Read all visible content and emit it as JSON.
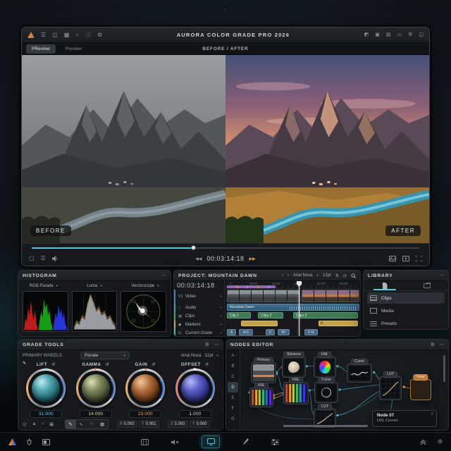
{
  "glyphs": {
    "menu": "☰",
    "dots": "⋯",
    "chev": "▾",
    "gear": "⚙",
    "info": "ⓘ",
    "reset": "↺",
    "prev": "‹",
    "next": "›",
    "close": "×",
    "plus": "+",
    "dot": "·",
    "updown": "⇅",
    "clock": "◷",
    "rew": "◀◀",
    "ffwd": "▶▶",
    "stop": "▢",
    "list": "☰",
    "grid": "▦",
    "circle": "○",
    "panel1": "▣",
    "panel2": "◩",
    "panel3": "▤",
    "panel4": "▭",
    "panel5": "◫",
    "pencil": "✎"
  },
  "titlebar": {
    "title": "AURORA COLOR GRADE PRO 2026"
  },
  "tabs": {
    "tab1": "PReview",
    "tab2": "Preview",
    "center": "BEFORE / AFTER"
  },
  "viewer": {
    "before": "BEFORE",
    "after": "AFTER"
  },
  "transport": {
    "timecode": "00:03:14:18",
    "progress_pct": 42
  },
  "histogram": {
    "title": "HISTOGRAM",
    "scopes": [
      "RGB Parade",
      "Luma",
      "Vectorscope"
    ]
  },
  "project": {
    "title": "PROJECT: MOUNTAIN DAWN",
    "timecode": "00:03:14:18",
    "font": "Arial Nova",
    "size": "12pt",
    "ruler": [
      "0",
      "00:01",
      "00:02",
      "00:03",
      "00:04",
      "00:05"
    ],
    "tracks": [
      {
        "badge": "V1",
        "label": "Video"
      },
      {
        "badge": "♪",
        "label": "Audio"
      },
      {
        "badge": "▤",
        "label": "Clips"
      },
      {
        "badge": "◆",
        "label": "Markers"
      },
      {
        "badge": "G",
        "label": "Current Grade"
      }
    ],
    "audio_clip": "Mountain Dawn",
    "clips": [
      "Clip 1",
      "Clips 2",
      "Clips 3"
    ],
    "marker_label": "A",
    "chips": [
      "A",
      "A-5",
      "C",
      "B7",
      "F-G"
    ],
    "playhead_pct": 55
  },
  "library": {
    "title": "LIBRARY",
    "items": [
      "Clips",
      "Media",
      "Presets"
    ]
  },
  "grade": {
    "title": "GRADE TOOLS",
    "subtitle": "PRIMARY WHEELS",
    "preset": "Ponate",
    "font": "Arial Nova",
    "size": "12pt",
    "wheels": [
      {
        "label": "LIFT",
        "value": "31.500",
        "value_color": "#56d0e0",
        "ball_color": "#3f98a4",
        "tick_color": "#56d0e0"
      },
      {
        "label": "GAMMA",
        "value": "14.000",
        "value_color": "#d6d88c",
        "ball_color": "#6d7a4f",
        "tick_color": "#e06a3a"
      },
      {
        "label": "GAIN",
        "value": "23.000",
        "value_color": "#e8a558",
        "ball_color": "#a85f33",
        "tick_color": "#e04a3a"
      },
      {
        "label": "OFFSET",
        "value": "1.000",
        "value_color": "#ced4da",
        "ball_color": "#5558c2",
        "tick_color": "#e8ecef"
      }
    ],
    "coords": [
      {
        "xl": "X",
        "xv": "0.000",
        "yl": "Y",
        "yv": "0.001"
      },
      {
        "xl": "X",
        "xv": "0.000",
        "yl": "Y",
        "yv": "0.000"
      }
    ]
  },
  "nodes": {
    "title": "NODES EDITOR",
    "rail": [
      "A",
      "B",
      "C",
      "D",
      "E",
      "F",
      "G"
    ],
    "labels": {
      "primary": "Primary",
      "skintone": "Skintone",
      "hsl": "HSL",
      "curve": "Curve",
      "lut": "LUT",
      "final": "Final"
    },
    "tooltip": {
      "title": "Node 07",
      "subtitle": "HSL Curves"
    }
  },
  "colors": {
    "accent_teal": "#56c8d8",
    "accent_orange": "#e8a050",
    "clip_green": "#3e7a55",
    "marker_yellow": "#c2a24a",
    "audio_blue": "#3f6e90",
    "grade_chip_blue": "#4a6a86",
    "node_final_orange": "#b87738",
    "purple_marker": "#9468b4"
  }
}
